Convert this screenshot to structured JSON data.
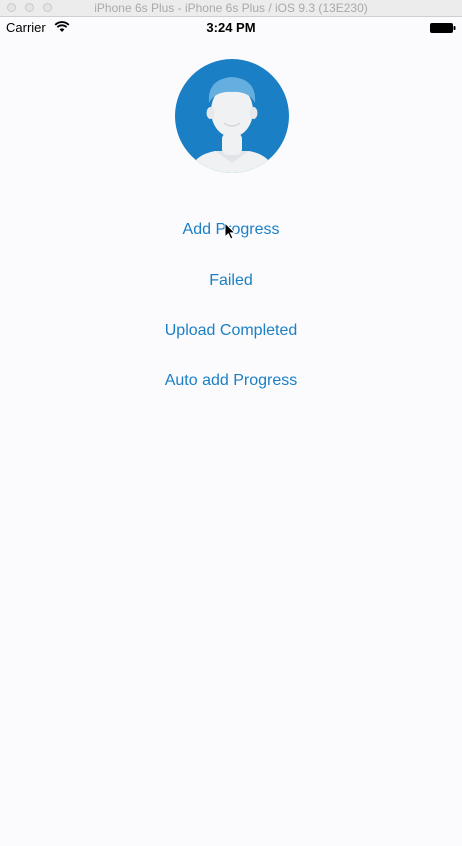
{
  "window": {
    "title": "iPhone 6s Plus - iPhone 6s Plus / iOS 9.3 (13E230)"
  },
  "status_bar": {
    "carrier": "Carrier",
    "time": "3:24 PM",
    "wifi_icon": "wifi-icon",
    "battery_icon": "battery-icon"
  },
  "avatar": {
    "icon": "user-avatar-icon",
    "colors": {
      "background": "#1a7fc4",
      "figure": "#f0f1f3",
      "hair": "#64aee0"
    }
  },
  "actions": [
    {
      "label": "Add Progress"
    },
    {
      "label": "Failed"
    },
    {
      "label": "Upload Completed"
    },
    {
      "label": "Auto add Progress"
    }
  ],
  "colors": {
    "accent": "#1a7fc4",
    "background": "#fbfbfd"
  }
}
